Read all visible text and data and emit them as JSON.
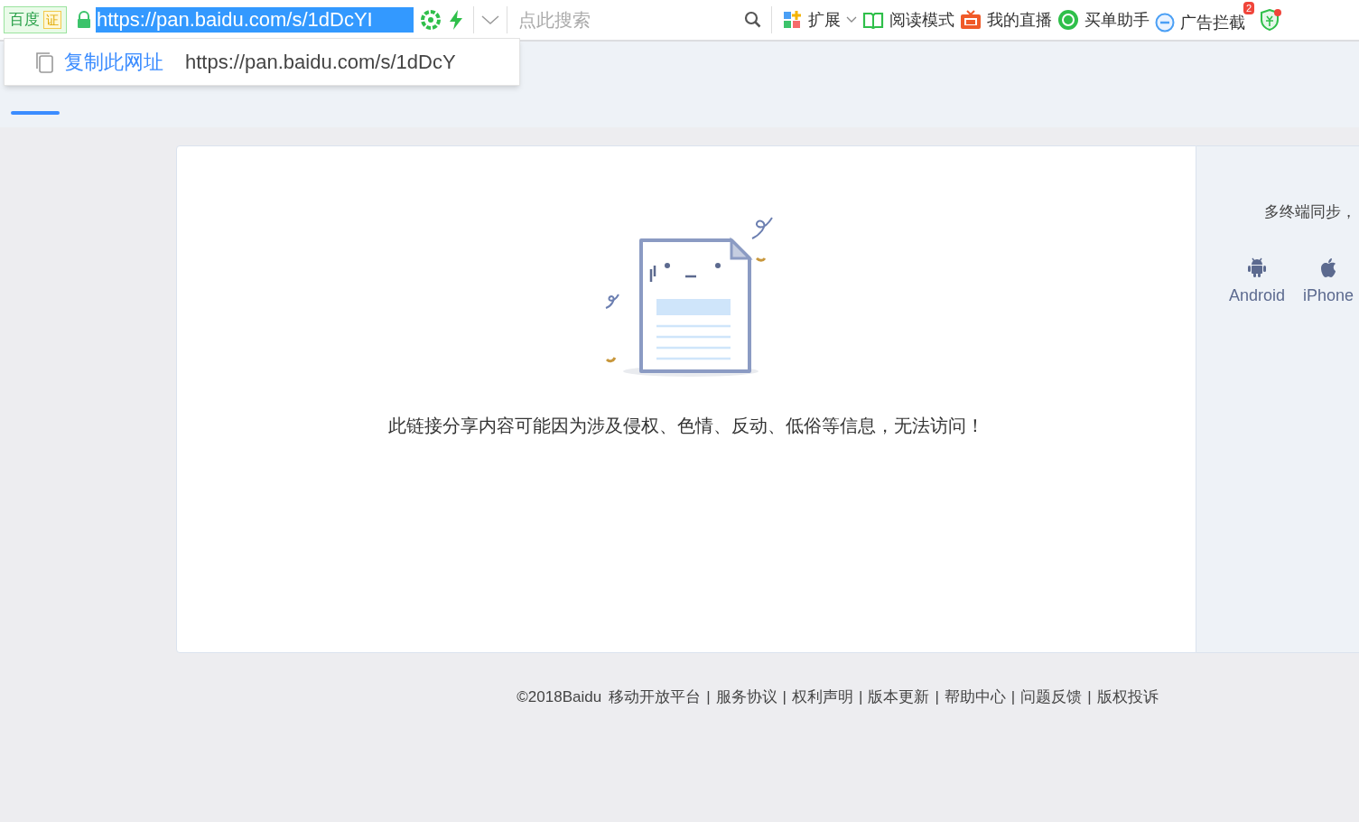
{
  "address_bar": {
    "site_badge": "百度",
    "cert_badge": "证",
    "url": "https://pan.baidu.com/s/1dDcYI",
    "url_selected": true,
    "search_placeholder": "点此搜索"
  },
  "toolbar": [
    {
      "kind": "extensions",
      "label": "扩展"
    },
    {
      "kind": "reader",
      "label": "阅读模式"
    },
    {
      "kind": "live",
      "label": "我的直播"
    },
    {
      "kind": "assistant",
      "label": "买单助手"
    },
    {
      "kind": "adblock",
      "label": "广告拦截",
      "badge": "2"
    },
    {
      "kind": "shield"
    }
  ],
  "copy_popup": {
    "action": "复制此网址",
    "url": "https://pan.baidu.com/s/1dDcY"
  },
  "message": "此链接分享内容可能因为涉及侵权、色情、反动、低俗等信息，无法访问！",
  "side_panel": {
    "title": "多终端同步，",
    "apps": [
      {
        "kind": "android",
        "label": "Android"
      },
      {
        "kind": "apple",
        "label": "iPhone"
      }
    ]
  },
  "footer": {
    "copyright": "©2018Baidu",
    "separator": "|",
    "links": [
      "移动开放平台",
      "服务协议",
      "权利声明",
      "版本更新",
      "帮助中心",
      "问题反馈",
      "版权投诉"
    ]
  }
}
